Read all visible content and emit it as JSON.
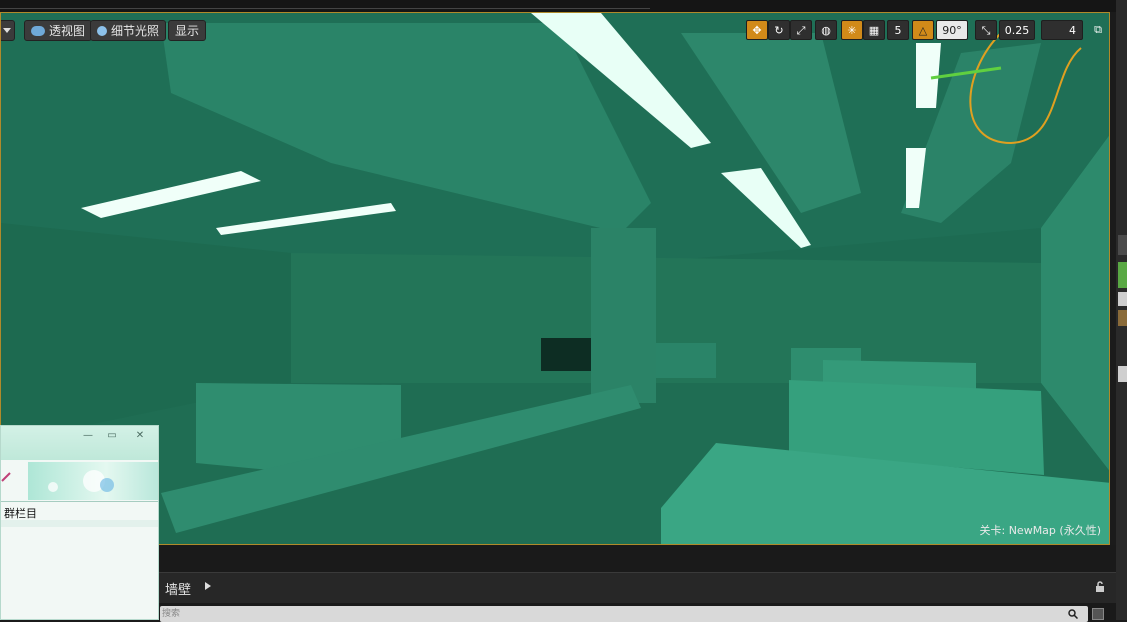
{
  "viewport_toolbar": {
    "perspective_label": "透视图",
    "lighting_label": "细节光照",
    "show_label": "显示",
    "grid_snap_value": "5",
    "rotation_snap_value": "90°",
    "scale_snap_value": "0.25",
    "camera_speed_value": "4"
  },
  "viewport": {
    "level_label": "关卡: NewMap (永久性)"
  },
  "bottom_panel": {
    "title": "墙壁",
    "search_placeholder": "搜索"
  },
  "floating_window": {
    "label": "群栏目"
  },
  "colors": {
    "viewport_border": "#b08a2a",
    "accent_orange": "#d18a19",
    "scene_green": "#1d6b52"
  }
}
